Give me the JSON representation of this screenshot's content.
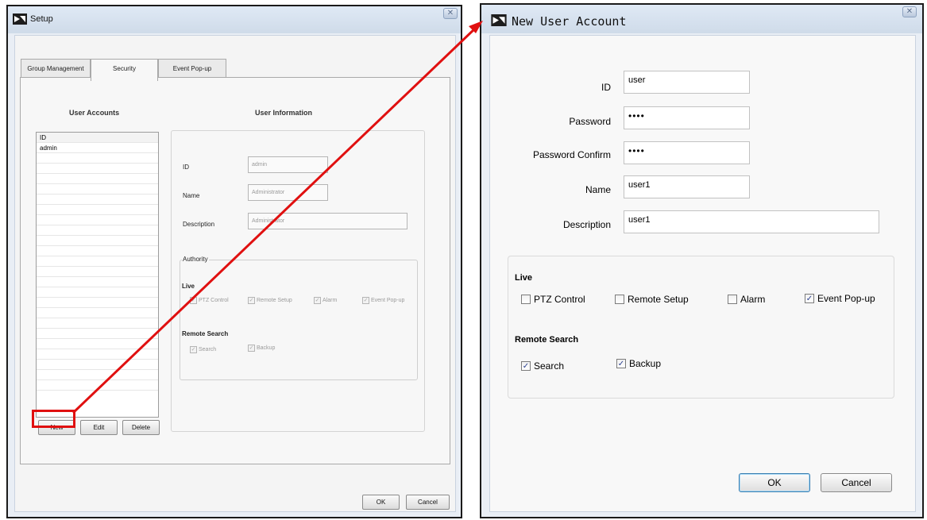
{
  "setup_window": {
    "title": "Setup",
    "close_glyph": "✕",
    "tabs": [
      {
        "label": "Group Management",
        "active": false
      },
      {
        "label": "Security",
        "active": true
      },
      {
        "label": "Event Pop-up",
        "active": false
      }
    ],
    "user_accounts": {
      "heading": "User Accounts",
      "column_header": "ID",
      "rows": [
        "admin"
      ],
      "buttons": {
        "new": "New",
        "edit": "Edit",
        "delete": "Delete"
      }
    },
    "user_information": {
      "heading": "User Information",
      "id_label": "ID",
      "id_value": "admin",
      "name_label": "Name",
      "name_value": "Administrator",
      "description_label": "Description",
      "description_value": "Administrator",
      "authority_label": "Authority",
      "live_label": "Live",
      "live_options": [
        {
          "label": "PTZ Control",
          "checked": true
        },
        {
          "label": "Remote Setup",
          "checked": true
        },
        {
          "label": "Alarm",
          "checked": true
        },
        {
          "label": "Event Pop-up",
          "checked": true
        }
      ],
      "remote_search_label": "Remote Search",
      "remote_search_options": [
        {
          "label": "Search",
          "checked": true
        },
        {
          "label": "Backup",
          "checked": true
        }
      ]
    },
    "footer": {
      "ok": "OK",
      "cancel": "Cancel"
    }
  },
  "new_user_window": {
    "title": "New User Account",
    "close_glyph": "✕",
    "fields": {
      "id_label": "ID",
      "id_value": "user",
      "password_label": "Password",
      "password_value": "••••",
      "password_confirm_label": "Password Confirm",
      "password_confirm_value": "••••",
      "name_label": "Name",
      "name_value": "user1",
      "description_label": "Description",
      "description_value": "user1"
    },
    "live_label": "Live",
    "live_options": [
      {
        "label": "PTZ Control",
        "checked": false
      },
      {
        "label": "Remote Setup",
        "checked": false
      },
      {
        "label": "Alarm",
        "checked": false
      },
      {
        "label": "Event Pop-up",
        "checked": true
      }
    ],
    "remote_search_label": "Remote Search",
    "remote_search_options": [
      {
        "label": "Search",
        "checked": true
      },
      {
        "label": "Backup",
        "checked": true
      }
    ],
    "buttons": {
      "ok": "OK",
      "cancel": "Cancel"
    },
    "check_glyph": "✓"
  },
  "annotation": {
    "color": "#e01010"
  },
  "colors": {
    "arrow": "#e01010",
    "titlebar": "#d6e2ef",
    "window_border": "#1a1a1a"
  }
}
